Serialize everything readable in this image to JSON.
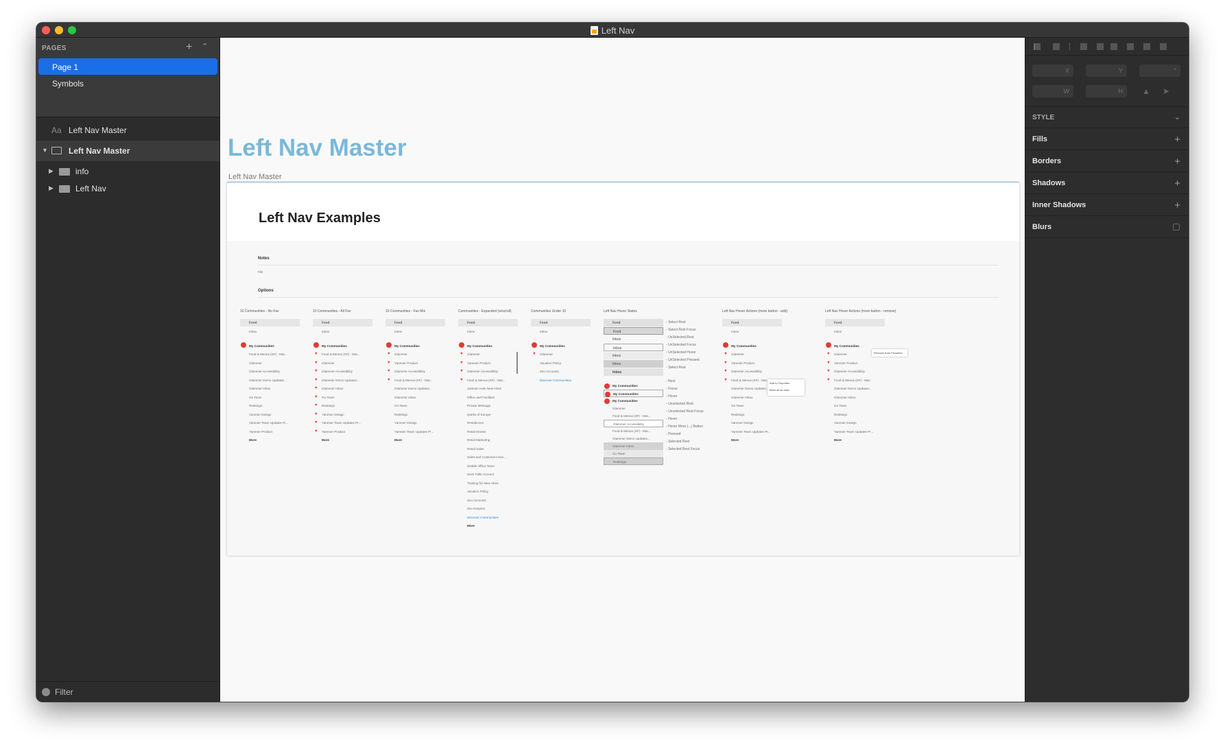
{
  "window": {
    "title": "Left Nav"
  },
  "pages": {
    "label": "PAGES",
    "items": [
      "Page 1",
      "Symbols"
    ]
  },
  "layers": {
    "text_layer": "Left Nav Master",
    "artboard": "Left Nav Master",
    "children": [
      "info",
      "Left Nav"
    ]
  },
  "filter": {
    "label": "Filter"
  },
  "canvas": {
    "big_title": "Left Nav Master",
    "artboard_label": "Left Nav Master"
  },
  "artboard": {
    "heading": "Left Nav Examples",
    "notes_label": "Notes",
    "notes_value": "n/a",
    "options_label": "Options",
    "columns": [
      "10 Communities - No Fav",
      "10 Communities - All Fav",
      "10 Communities - Fav Mix",
      "Communities - Expanded (w/scroll)",
      "Communities Under 10",
      "Left Nav Hover States",
      "Left Nav Hover Actions (more button - add)",
      "Left Nav Hover Actions (more button - remove)"
    ],
    "feed": "Feed",
    "inbox": "Inbox",
    "my_communities": "My Communities",
    "more": "More",
    "discover": "Discover Communities",
    "list_a": [
      "Food & Menus (SF) - Mar...",
      "Glammer",
      "Glammer Accessibility",
      "Glammer Demo Updates...",
      "Glammer Inbox",
      "Go Team",
      "Redesign",
      "Yammer Design",
      "Yammer Team Updates Pr...",
      "Yammer Product"
    ],
    "list_c": [
      "Glammer",
      "Yammer Product",
      "Glammer Accessibility",
      "Food & Menus (SF) - Mar...",
      "Glammer Demo Updates...",
      "Glammer Inbox",
      "Go Team",
      "Redesign",
      "Yammer Design",
      "Yammer Team Updates Pr..."
    ],
    "list_d": [
      "Glammer",
      "Yammer Product",
      "Glammer Accessibility",
      "Food & Menus (SF) - Mar...",
      "Jackson Hole New Hires",
      "Office and Facilities",
      "Private Message",
      "Quirks of Europe",
      "Residences",
      "Retail Stories",
      "Retail Marketing",
      "Retail Sales",
      "Sales and Customers Exe...",
      "Seattle Office Team",
      "Sven Falls Account",
      "Training for New Hires",
      "Vacation Policy",
      "Zoo Accounts",
      "Zoo Keepers"
    ],
    "list_e": [
      "Glammer",
      "Vacation Policy",
      "Zoo Accounts"
    ],
    "states": [
      "Select Rest",
      "Select Rest Focus",
      "UnSelected Rest",
      "UnSelected Focus",
      "UnSelected Hover",
      "UnSelected Pressed",
      "Select Rest",
      "Rest",
      "Focus",
      "Hover",
      "Unselected Rest",
      "Unselected Rest Focus",
      "Hover",
      "Hover More (...) Button",
      "Pressed",
      "Selected Rest",
      "Selected Rest Focus"
    ],
    "menu_add": [
      "Add to Favorites",
      "Mark all as read"
    ],
    "menu_remove": "Remove from Favorites"
  },
  "inspector": {
    "fields": [
      "X",
      "Y",
      "W",
      "H"
    ],
    "style_label": "STYLE",
    "sections": [
      "Fills",
      "Borders",
      "Shadows",
      "Inner Shadows",
      "Blurs"
    ]
  }
}
